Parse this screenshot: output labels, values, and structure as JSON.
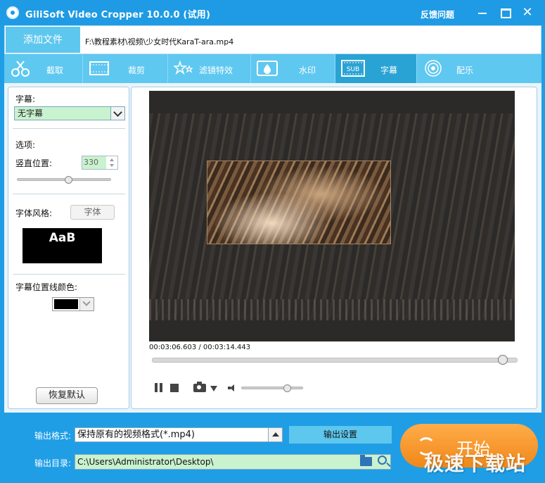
{
  "window": {
    "title": "GiliSoft Video Cropper 10.0.0 (试用)",
    "feedback": "反馈问题",
    "minimize": "",
    "maximize": "",
    "close": "✕"
  },
  "file": {
    "add_button": "添加文件",
    "path": "F:\\教程素材\\视频\\少女时代KaraT-ara.mp4"
  },
  "tabs": [
    {
      "label": "截取",
      "icon": "cut-icon"
    },
    {
      "label": "裁剪",
      "icon": "crop-icon"
    },
    {
      "label": "滤镜特效",
      "icon": "effects-icon"
    },
    {
      "label": "水印",
      "icon": "watermark-icon"
    },
    {
      "label": "字幕",
      "icon": "subtitle-icon",
      "active": true
    },
    {
      "label": "配乐",
      "icon": "music-icon"
    }
  ],
  "subtitle_panel": {
    "subtitle_label": "字幕:",
    "subtitle_value": "无字幕",
    "options_label": "选项:",
    "vertical_position_label": "竖直位置:",
    "vertical_position_value": "330",
    "vertical_slider_fraction": 0.55,
    "font_style_label": "字体风格:",
    "font_button": "字体",
    "font_preview": "AaB",
    "line_color_label": "字幕位置线颜色:",
    "line_color": "#000000",
    "reset_button": "恢复默认"
  },
  "player": {
    "time_readout": "00:03:06.603 / 00:03:14.443",
    "progress_fraction": 0.96,
    "volume_fraction": 0.75
  },
  "output": {
    "format_label": "输出格式:",
    "format_value": "保持原有的视频格式(*.mp4)",
    "settings_button": "输出设置",
    "dir_label": "输出目录:",
    "dir_value": "C:\\Users\\Administrator\\Desktop\\",
    "start_button": "开始"
  },
  "watermark_text": "极速下载站",
  "colors": {
    "titlebar": "#1e9be4",
    "tab_bar": "#5fc8f0",
    "tab_active": "#29a3d4",
    "start_button": "#f59a2e",
    "field_green": "#c9f2cf"
  }
}
